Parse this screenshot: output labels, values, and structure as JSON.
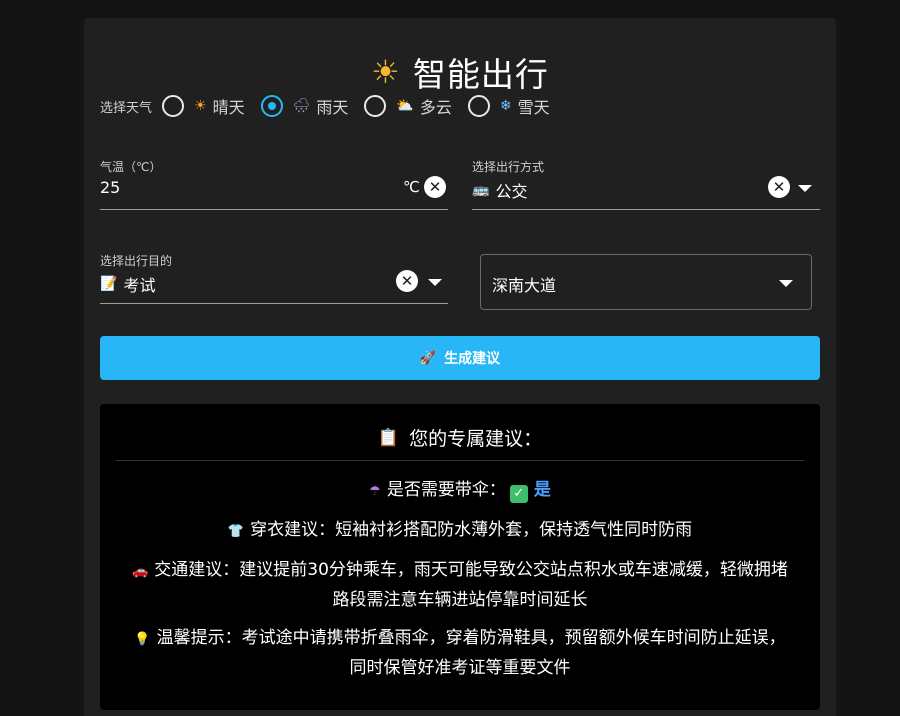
{
  "app": {
    "title": "智能出行",
    "title_icon": "☀"
  },
  "weather": {
    "label": "选择天气",
    "options": [
      {
        "icon": "☀",
        "label": "晴天",
        "selected": false
      },
      {
        "icon": "🌧",
        "label": "雨天",
        "selected": true
      },
      {
        "icon": "⛅",
        "label": "多云",
        "selected": false
      },
      {
        "icon": "❄",
        "label": "雪天",
        "selected": false
      }
    ]
  },
  "temperature": {
    "label": "气温（℃）",
    "value": "25",
    "unit": "℃"
  },
  "transport": {
    "label": "选择出行方式",
    "icon": "🚌",
    "value": "公交"
  },
  "purpose": {
    "label": "选择出行目的",
    "icon": "📝",
    "value": "考试"
  },
  "road": {
    "value": "深南大道"
  },
  "generate_button": {
    "icon": "🚀",
    "label": "生成建议"
  },
  "result": {
    "title_icon": "📋",
    "title": "您的专属建议：",
    "umbrella": {
      "icon": "☂",
      "label": "是否需要带伞：",
      "check": "✓",
      "value": "是"
    },
    "clothing": {
      "icon": "👕",
      "text": "穿衣建议：短袖衬衫搭配防水薄外套，保持透气性同时防雨"
    },
    "traffic": {
      "icon": "🚗",
      "line1": "交通建议：建议提前30分钟乘车，雨天可能导致公交站点积水或车速减缓，轻微拥堵",
      "line2": "路段需注意车辆进站停靠时间延长"
    },
    "tip": {
      "icon": "💡",
      "line1": "温馨提示：考试途中请携带折叠雨伞，穿着防滑鞋具，预留额外候车时间防止延误，",
      "line2": "同时保管好准考证等重要文件"
    }
  },
  "colors": {
    "accent": "#29b6f6",
    "background": "#141414",
    "card": "#202020",
    "result_bg": "#000000"
  }
}
